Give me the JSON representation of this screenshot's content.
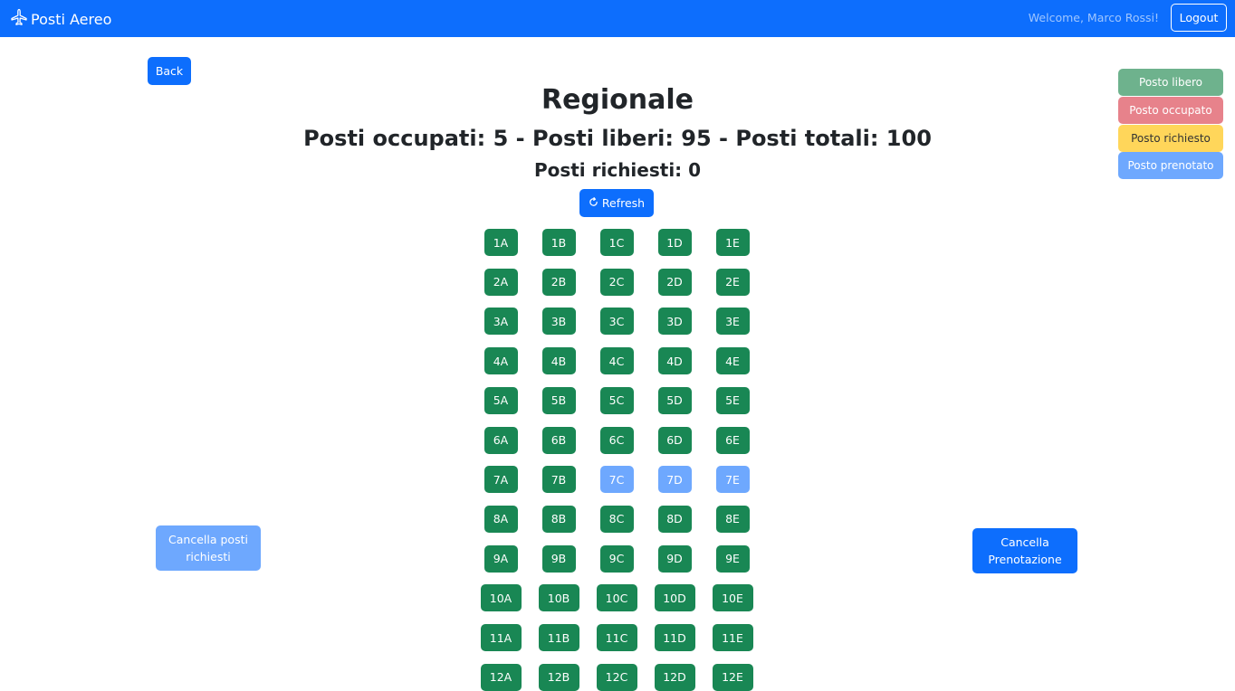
{
  "navbar": {
    "brand": "Posti Aereo",
    "brand_icon": "airplane-icon",
    "welcome": "Welcome, Marco Rossi!",
    "logout_label": "Logout"
  },
  "back_label": "Back",
  "legend": {
    "libero": "Posto libero",
    "occupato": "Posto occupato",
    "richiesto": "Posto richiesto",
    "prenotato": "Posto prenotato"
  },
  "title": "Regionale",
  "stats": "Posti occupati: 5 - Posti liberi: 95 - Posti totali: 100",
  "requested": "Posti richiesti: 0",
  "refresh_label": "Refresh",
  "cancel_requested_label": "Cancella posti richiesti",
  "cancel_booking_label": "Cancella Prenotazione",
  "colors": {
    "primary": "#0d6efd",
    "libero": "#198754",
    "prenotato": "#6ea8fe",
    "occupato": "#e7828b",
    "richiesto": "#ffd65a"
  },
  "seat_columns": [
    "A",
    "B",
    "C",
    "D",
    "E"
  ],
  "seat_rows": [
    {
      "row": "1",
      "seats": [
        {
          "label": "1A",
          "status": "libero"
        },
        {
          "label": "1B",
          "status": "libero"
        },
        {
          "label": "1C",
          "status": "libero"
        },
        {
          "label": "1D",
          "status": "libero"
        },
        {
          "label": "1E",
          "status": "libero"
        }
      ]
    },
    {
      "row": "2",
      "seats": [
        {
          "label": "2A",
          "status": "libero"
        },
        {
          "label": "2B",
          "status": "libero"
        },
        {
          "label": "2C",
          "status": "libero"
        },
        {
          "label": "2D",
          "status": "libero"
        },
        {
          "label": "2E",
          "status": "libero"
        }
      ]
    },
    {
      "row": "3",
      "seats": [
        {
          "label": "3A",
          "status": "libero"
        },
        {
          "label": "3B",
          "status": "libero"
        },
        {
          "label": "3C",
          "status": "libero"
        },
        {
          "label": "3D",
          "status": "libero"
        },
        {
          "label": "3E",
          "status": "libero"
        }
      ]
    },
    {
      "row": "4",
      "seats": [
        {
          "label": "4A",
          "status": "libero"
        },
        {
          "label": "4B",
          "status": "libero"
        },
        {
          "label": "4C",
          "status": "libero"
        },
        {
          "label": "4D",
          "status": "libero"
        },
        {
          "label": "4E",
          "status": "libero"
        }
      ]
    },
    {
      "row": "5",
      "seats": [
        {
          "label": "5A",
          "status": "libero"
        },
        {
          "label": "5B",
          "status": "libero"
        },
        {
          "label": "5C",
          "status": "libero"
        },
        {
          "label": "5D",
          "status": "libero"
        },
        {
          "label": "5E",
          "status": "libero"
        }
      ]
    },
    {
      "row": "6",
      "seats": [
        {
          "label": "6A",
          "status": "libero"
        },
        {
          "label": "6B",
          "status": "libero"
        },
        {
          "label": "6C",
          "status": "libero"
        },
        {
          "label": "6D",
          "status": "libero"
        },
        {
          "label": "6E",
          "status": "libero"
        }
      ]
    },
    {
      "row": "7",
      "seats": [
        {
          "label": "7A",
          "status": "libero"
        },
        {
          "label": "7B",
          "status": "libero"
        },
        {
          "label": "7C",
          "status": "prenotato"
        },
        {
          "label": "7D",
          "status": "prenotato"
        },
        {
          "label": "7E",
          "status": "prenotato"
        }
      ]
    },
    {
      "row": "8",
      "seats": [
        {
          "label": "8A",
          "status": "libero"
        },
        {
          "label": "8B",
          "status": "libero"
        },
        {
          "label": "8C",
          "status": "libero"
        },
        {
          "label": "8D",
          "status": "libero"
        },
        {
          "label": "8E",
          "status": "libero"
        }
      ]
    },
    {
      "row": "9",
      "seats": [
        {
          "label": "9A",
          "status": "libero"
        },
        {
          "label": "9B",
          "status": "libero"
        },
        {
          "label": "9C",
          "status": "libero"
        },
        {
          "label": "9D",
          "status": "libero"
        },
        {
          "label": "9E",
          "status": "libero"
        }
      ]
    },
    {
      "row": "10",
      "seats": [
        {
          "label": "10A",
          "status": "libero"
        },
        {
          "label": "10B",
          "status": "libero"
        },
        {
          "label": "10C",
          "status": "libero"
        },
        {
          "label": "10D",
          "status": "libero"
        },
        {
          "label": "10E",
          "status": "libero"
        }
      ]
    },
    {
      "row": "11",
      "seats": [
        {
          "label": "11A",
          "status": "libero"
        },
        {
          "label": "11B",
          "status": "libero"
        },
        {
          "label": "11C",
          "status": "libero"
        },
        {
          "label": "11D",
          "status": "libero"
        },
        {
          "label": "11E",
          "status": "libero"
        }
      ]
    },
    {
      "row": "12",
      "seats": [
        {
          "label": "12A",
          "status": "libero"
        },
        {
          "label": "12B",
          "status": "libero"
        },
        {
          "label": "12C",
          "status": "libero"
        },
        {
          "label": "12D",
          "status": "libero"
        },
        {
          "label": "12E",
          "status": "libero"
        }
      ]
    }
  ]
}
